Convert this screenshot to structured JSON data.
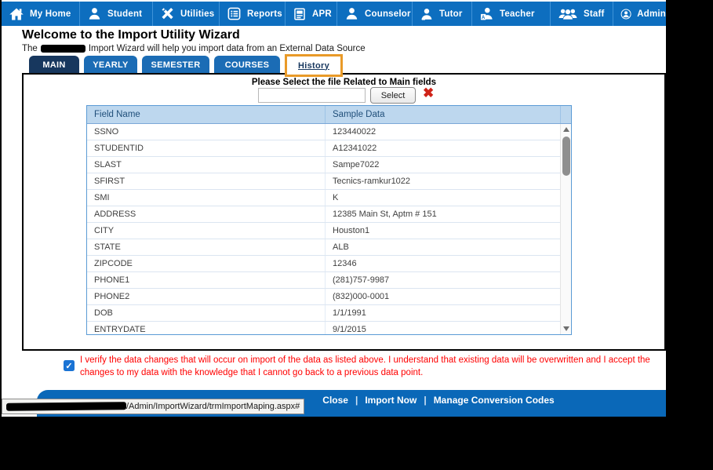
{
  "navbar": {
    "items": [
      {
        "label": "My Home",
        "icon": "home-icon"
      },
      {
        "label": "Student",
        "icon": "student-icon"
      },
      {
        "label": "Utilities",
        "icon": "tools-icon"
      },
      {
        "label": "Reports",
        "icon": "report-list-icon"
      },
      {
        "label": "APR",
        "icon": "journal-icon"
      },
      {
        "label": "Counselor",
        "icon": "person-icon"
      },
      {
        "label": "Tutor",
        "icon": "person-icon"
      },
      {
        "label": "Teacher",
        "icon": "teacher-badge-icon"
      },
      {
        "label": "Staff",
        "icon": "people-group-icon"
      },
      {
        "label": "Admin",
        "icon": "person-circle-icon"
      }
    ]
  },
  "header": {
    "title": "Welcome to the Import Utility Wizard",
    "subtitle_prefix": "The",
    "subtitle_suffix": "Import Wizard will help you import data from an External Data Source"
  },
  "tabs": [
    {
      "label": "MAIN",
      "state": "active"
    },
    {
      "label": "YEARLY",
      "state": "normal"
    },
    {
      "label": "SEMESTER",
      "state": "normal"
    },
    {
      "label": "COURSES",
      "state": "normal"
    },
    {
      "label": "History",
      "state": "highlighted"
    }
  ],
  "file_select": {
    "prompt": "Please Select the file Related to Main fields",
    "input_value": "",
    "button_label": "Select",
    "clear_glyph": "✖",
    "clear_icon": "red-x-icon"
  },
  "table": {
    "columns": [
      "Field Name",
      "Sample Data"
    ],
    "rows": [
      [
        "SSNO",
        "123440022"
      ],
      [
        "STUDENTID",
        "A12341022"
      ],
      [
        "SLAST",
        "Sampe7022"
      ],
      [
        "SFIRST",
        "Tecnics-ramkur1022"
      ],
      [
        "SMI",
        "K"
      ],
      [
        "ADDRESS",
        "12385 Main St, Aptm # 151"
      ],
      [
        "CITY",
        "Houston1"
      ],
      [
        "STATE",
        "ALB"
      ],
      [
        "ZIPCODE",
        "12346"
      ],
      [
        "PHONE1",
        "(281)757-9987"
      ],
      [
        "PHONE2",
        "(832)000-0001"
      ],
      [
        "DOB",
        "1/1/1991"
      ],
      [
        "ENTRYDATE",
        "9/1/2015"
      ]
    ]
  },
  "verify": {
    "checked": true,
    "check_glyph": "✓",
    "text": "I verify the data changes that will occur on import of the data as listed above. I understand that existing data will be overwritten and I accept the changes to my data with the knowledge that I cannot go back to a previous data point."
  },
  "footer": {
    "links": [
      "Close",
      "Import Now",
      "Manage Conversion Codes"
    ],
    "separator": "|"
  },
  "statusbar": {
    "url_visible": "/Admin/ImportWizard/trmImportMaping.aspx#"
  },
  "colors": {
    "nav_blue": "#0d6ebf",
    "tab_active": "#17375e",
    "tab_blue": "#1b6cb5",
    "highlight_orange": "#e99a28",
    "table_header_bg": "#bdd7ee",
    "table_border": "#5b9bd5",
    "warning_red": "#ff0000",
    "footer_blue": "#0a68b8",
    "clear_red": "#cf2318"
  }
}
